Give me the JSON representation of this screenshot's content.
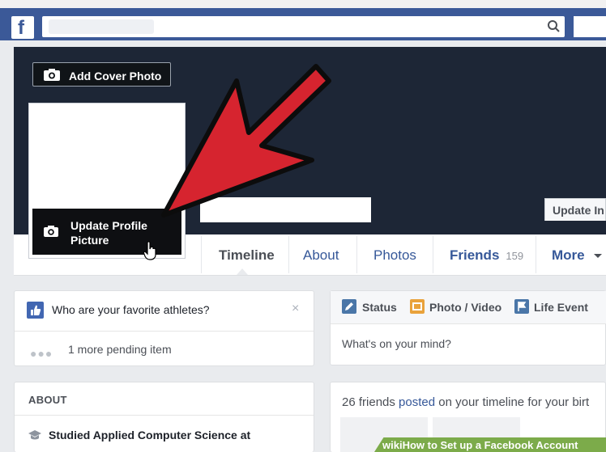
{
  "header": {
    "logo_letter": "f"
  },
  "cover": {
    "add_cover_label": "Add Cover Photo",
    "update_info_label": "Update In"
  },
  "profile": {
    "update_picture_line1": "Update Profile",
    "update_picture_line2": "Picture"
  },
  "nav": {
    "tabs": [
      {
        "label": "Timeline"
      },
      {
        "label": "About"
      },
      {
        "label": "Photos"
      },
      {
        "label": "Friends",
        "count": "159"
      },
      {
        "label": "More"
      }
    ]
  },
  "suggestion_card": {
    "question": "Who are your favorite athletes?",
    "close_symbol": "×",
    "pending_text": "1 more pending item"
  },
  "composer": {
    "tabs": [
      {
        "label": "Status"
      },
      {
        "label": "Photo / Video"
      },
      {
        "label": "Life Event"
      }
    ],
    "placeholder": "What's on your mind?"
  },
  "about": {
    "header": "ABOUT",
    "education": "Studied Applied Computer Science at"
  },
  "feed": {
    "prefix": "26 friends ",
    "link": "posted",
    "suffix": " on your timeline for your birt"
  },
  "watermark": {
    "text": "wikiHow to Set up a Facebook Account"
  },
  "colors": {
    "brand_blue": "#3b5998",
    "cover_dark": "#1d2636",
    "arrow_red": "#d6242f",
    "link_blue": "#365899"
  }
}
